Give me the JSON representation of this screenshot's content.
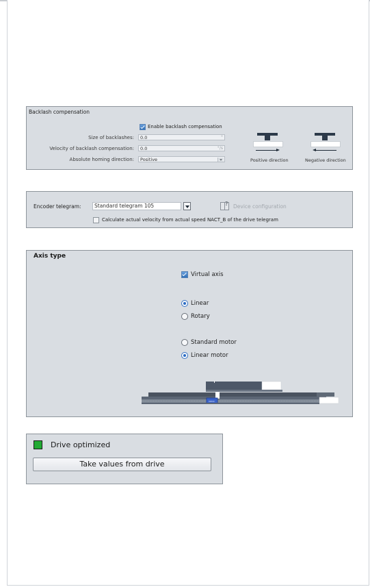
{
  "backlash": {
    "title": "Backlash compensation",
    "enable_label": "Enable backlash compensation",
    "size_label": "Size of backlashes:",
    "size_value": "0.0",
    "size_unit": "°",
    "velocity_label": "Velocity of backlash compensation:",
    "velocity_value": "0.0",
    "velocity_unit": "°/s",
    "homing_label": "Absolute homing direction:",
    "homing_value": "Positive",
    "positive_caption": "Positive direction",
    "negative_caption": "Negative direction"
  },
  "encoder": {
    "telegram_label": "Encoder telegram:",
    "telegram_value": "Standard telegram 105",
    "device_config_label": "Device configuration",
    "calc_velocity_label": "Calculate actual velocity from actual speed NACT_B of the drive telegram"
  },
  "axis_type": {
    "title": "Axis type",
    "virtual_axis_label": "Virtual axis",
    "linear_label": "Linear",
    "rotary_label": "Rotary",
    "standard_motor_label": "Standard motor",
    "linear_motor_label": "Linear motor"
  },
  "drive": {
    "optimized_label": "Drive optimized",
    "take_values_label": "Take values from drive",
    "status_color": "#22aa33"
  }
}
